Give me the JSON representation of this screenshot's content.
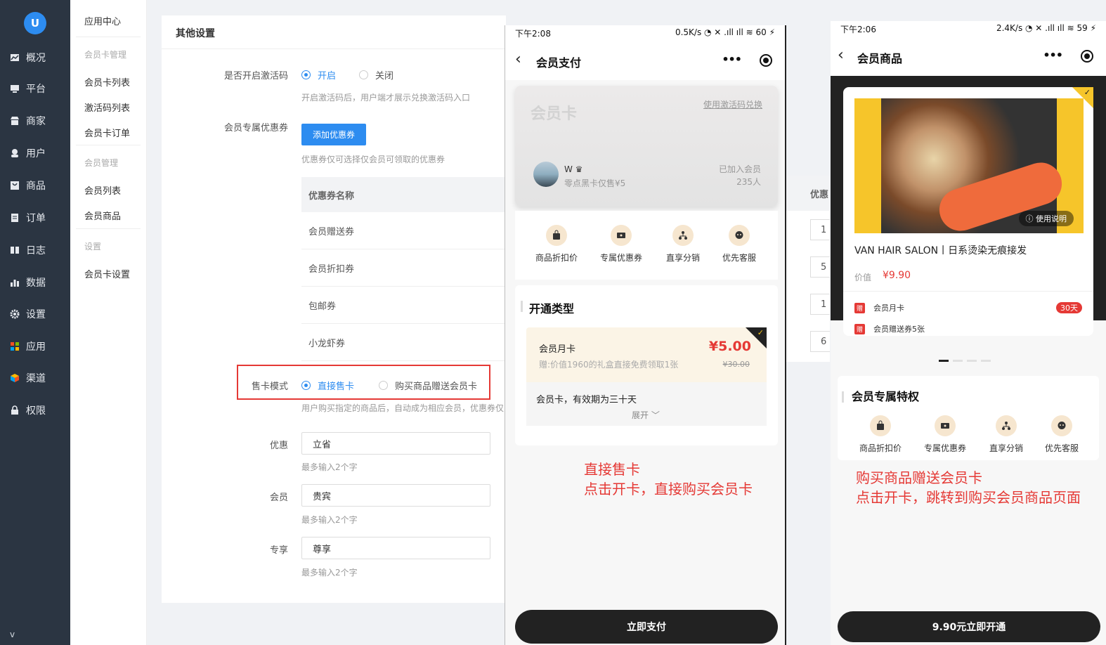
{
  "sidebar": {
    "logo": "U",
    "items": [
      {
        "label": "概况",
        "icon": "chart-card-icon"
      },
      {
        "label": "平台",
        "icon": "monitor-icon"
      },
      {
        "label": "商家",
        "icon": "store-icon"
      },
      {
        "label": "用户",
        "icon": "user-icon"
      },
      {
        "label": "商品",
        "icon": "goods-icon"
      },
      {
        "label": "订单",
        "icon": "order-icon"
      },
      {
        "label": "日志",
        "icon": "log-icon"
      },
      {
        "label": "数据",
        "icon": "bar-chart-icon"
      },
      {
        "label": "设置",
        "icon": "gear-icon"
      },
      {
        "label": "应用",
        "icon": "apps-icon"
      },
      {
        "label": "渠道",
        "icon": "cube-icon"
      },
      {
        "label": "权限",
        "icon": "lock-icon"
      }
    ],
    "bottom": "v"
  },
  "submenu": {
    "title": "应用中心",
    "groups": [
      {
        "label": "会员卡管理",
        "items": [
          "会员卡列表",
          "激活码列表",
          "会员卡订单"
        ]
      },
      {
        "label": "会员管理",
        "items": [
          "会员列表",
          "会员商品"
        ]
      },
      {
        "label": "设置",
        "items": [
          "会员卡设置"
        ]
      }
    ]
  },
  "settings": {
    "title": "其他设置",
    "activation": {
      "label": "是否开启激活码",
      "on": "开启",
      "off": "关闭",
      "hint": "开启激活码后，用户端才展示兑换激活码入口"
    },
    "coupon": {
      "label": "会员专属优惠券",
      "button": "添加优惠券",
      "hint": "优惠券仅可选择仅会员可领取的优惠券",
      "column": "优惠券名称",
      "rows": [
        "会员赠送券",
        "会员折扣券",
        "包邮券",
        "小龙虾券"
      ]
    },
    "sale_mode": {
      "label": "售卡模式",
      "opt1": "直接售卡",
      "opt2": "购买商品赠送会员卡",
      "hint": "用户购买指定的商品后，自动成为相应会员，优惠券仅"
    },
    "fields": [
      {
        "label": "优惠",
        "value": "立省",
        "hint": "最多输入2个字"
      },
      {
        "label": "会员",
        "value": "贵宾",
        "hint": "最多输入2个字"
      },
      {
        "label": "专享",
        "value": "尊享",
        "hint": "最多输入2个字"
      }
    ]
  },
  "right_table": {
    "head": "优惠",
    "cells": [
      "1",
      "5",
      "1",
      "6"
    ]
  },
  "phone1": {
    "time": "下午2:08",
    "status": "0.5K/s ◔ ✕ .ıll ıll ≋ 60 ⚡",
    "title": "会员支付",
    "card": {
      "title": "会员卡",
      "link": "使用激活码兑换",
      "name": "W ♛",
      "sub": "零点黑卡仅售¥5",
      "joined": "已加入会员",
      "count": "235人"
    },
    "perks": [
      "商品折扣价",
      "专属优惠券",
      "直享分销",
      "优先客服"
    ],
    "section": "开通类型",
    "plan": {
      "name": "会员月卡",
      "gift": "赠:价值1960的礼盒直接免费领取1张",
      "price": "¥5.00",
      "old": "¥30.00",
      "desc": "会员卡，有效期为三十天",
      "expand": "展开 ﹀",
      "tick": "✓"
    },
    "annotation": [
      "直接售卡",
      "点击开卡，直接购买会员卡"
    ],
    "pay": "立即支付"
  },
  "phone2": {
    "time": "下午2:06",
    "status": "2.4K/s ◔ ✕ .ıll ıll ≋ 59 ⚡",
    "title": "会员商品",
    "product": {
      "tip": "ⓘ 使用说明",
      "title": "VAN HAIR SALON丨日系烫染无痕接发",
      "value_label": "价值",
      "price": "¥9.90",
      "gift_tag": "赠",
      "gifts": [
        "会员月卡",
        "会员赠送券5张"
      ],
      "days": "30天",
      "tick": "✓"
    },
    "section": "会员专属特权",
    "perks": [
      "商品折扣价",
      "专属优惠券",
      "直享分销",
      "优先客服"
    ],
    "annotation": [
      "购买商品赠送会员卡",
      "点击开卡，跳转到购买会员商品页面"
    ],
    "pay": "9.90元立即开通"
  },
  "colors": {
    "sidebar": "#2b3542",
    "primary": "#2d8cf0",
    "red": "#e53935",
    "dark": "#222222",
    "gold": "#f6c52a"
  }
}
